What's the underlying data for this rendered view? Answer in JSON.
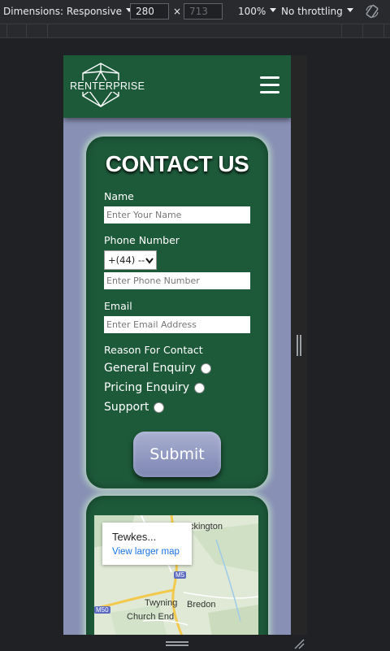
{
  "devtools": {
    "dimensions_label": "Dimensions: Responsive",
    "width_value": "280",
    "height_value": "713",
    "times_symbol": "×",
    "zoom_label": "100%",
    "throttling_label": "No throttling"
  },
  "header": {
    "logo_text": "RENTERPRISE"
  },
  "contact": {
    "title": "CONTACT US",
    "name_label": "Name",
    "name_placeholder": "Enter Your Name",
    "phone_label": "Phone Number",
    "country_code_selected": "+(44) --",
    "phone_placeholder": "Enter Phone Number",
    "email_label": "Email",
    "email_placeholder": "Enter Email Address",
    "reason_label": "Reason For Contact",
    "reasons": [
      "General Enquiry",
      "Pricing Enquiry",
      "Support"
    ],
    "submit_label": "Submit"
  },
  "map": {
    "popup_title": "Tewkes...",
    "popup_link": "View larger map",
    "place_labels": {
      "ckington": "ckington",
      "twyning": "Twyning",
      "bredon": "Bredon",
      "church_end": "Church End"
    },
    "road_m5": "M5",
    "road_m50": "M50"
  },
  "colors": {
    "header_green": "#1d5a3a",
    "page_bg": "#8890b5",
    "submit_button": "#9aa2c6"
  }
}
